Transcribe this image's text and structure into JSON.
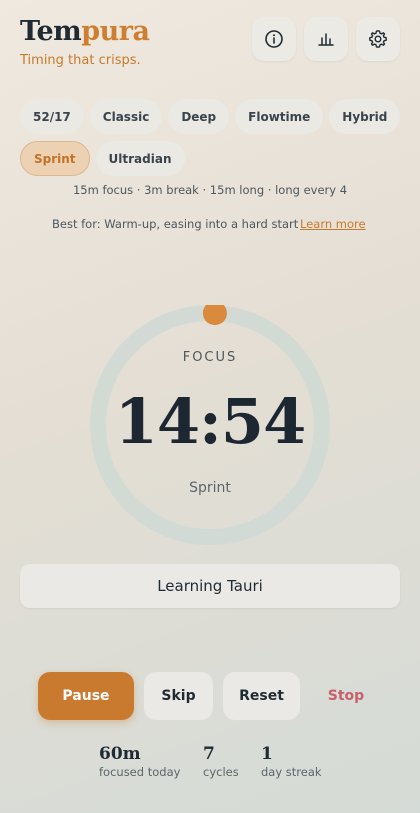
{
  "brand": {
    "title_part1": "Tem",
    "title_part2": "pura",
    "tagline": "Timing that crisps."
  },
  "toolbar": {
    "info_icon": "info-icon",
    "stats_icon": "bar-chart-icon",
    "settings_icon": "gear-icon"
  },
  "presets": {
    "row1": [
      "52/17",
      "Classic",
      "Deep",
      "Flowtime",
      "Hybrid"
    ],
    "row2": [
      "Sprint",
      "Ultradian"
    ],
    "selected": "Sprint"
  },
  "summary": "15m focus · 3m break · 15m long · long every 4",
  "best_for": "Best for: Warm-up, easing into a hard start",
  "learn_more": "Learn more",
  "timer": {
    "phase": "FOCUS",
    "time": "14:54",
    "mode": "Sprint",
    "progress_fraction": 0.007
  },
  "task": "Learning Tauri",
  "controls": {
    "pause": "Pause",
    "skip": "Skip",
    "reset": "Reset",
    "stop": "Stop"
  },
  "stats": [
    {
      "value": "60m",
      "label": "focused today"
    },
    {
      "value": "7",
      "label": "cycles"
    },
    {
      "value": "1",
      "label": "day streak"
    }
  ],
  "colors": {
    "accent": "#c97a2f",
    "danger": "#c8606a",
    "ring_track": "#ccd8d4"
  }
}
